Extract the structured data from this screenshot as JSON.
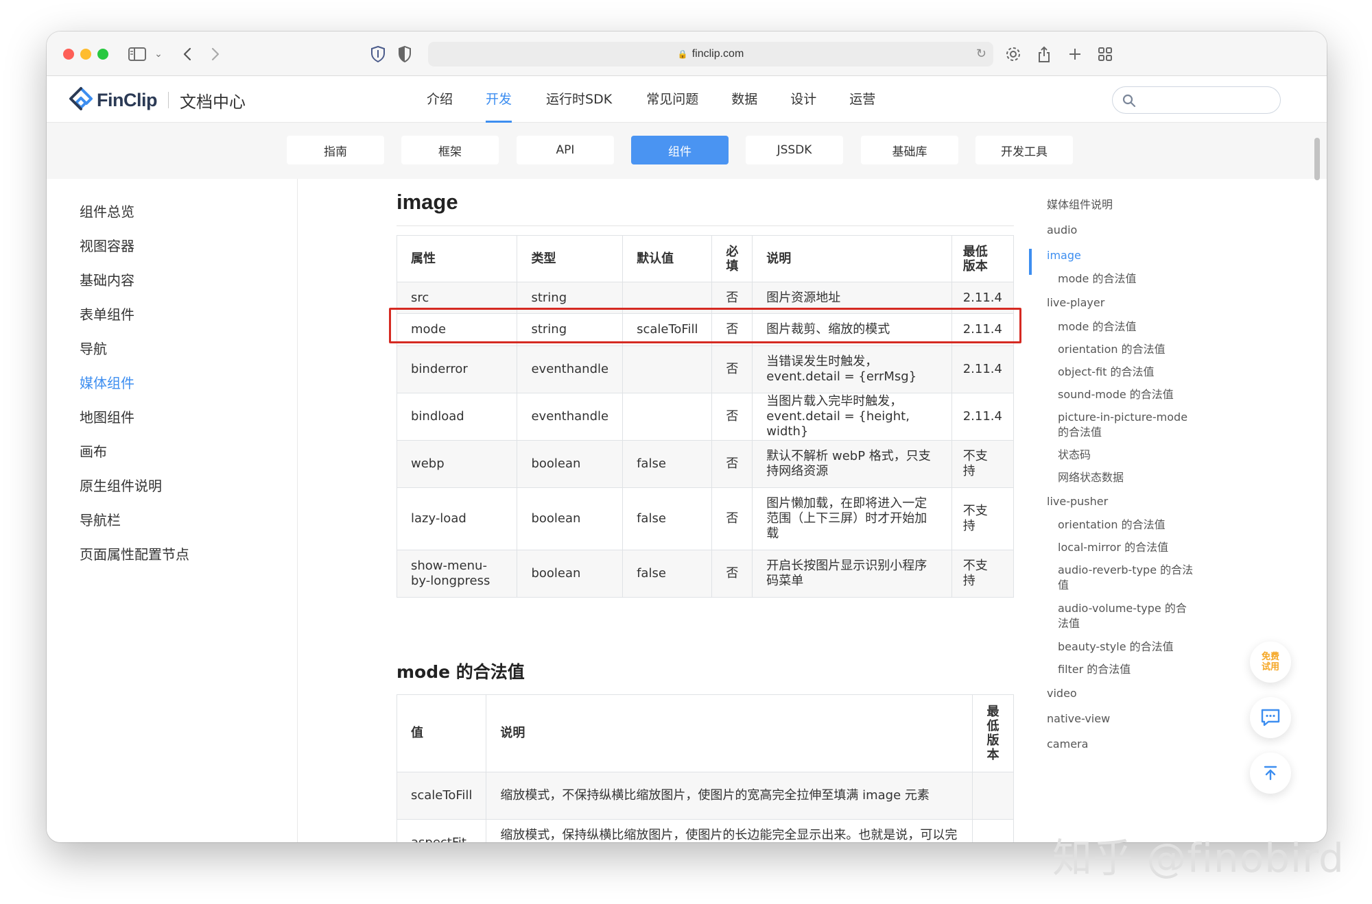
{
  "browser": {
    "url": "finclip.com"
  },
  "site": {
    "logo_text": "FinClip",
    "logo_subtitle": "文档中心",
    "nav": [
      {
        "label": "介绍"
      },
      {
        "label": "开发"
      },
      {
        "label": "运行时SDK"
      },
      {
        "label": "常见问题"
      },
      {
        "label": "数据"
      },
      {
        "label": "设计"
      },
      {
        "label": "运营"
      }
    ],
    "nav_active": "开发",
    "search_placeholder": ""
  },
  "subnav": [
    {
      "label": "指南"
    },
    {
      "label": "框架"
    },
    {
      "label": "API"
    },
    {
      "label": "组件"
    },
    {
      "label": "JSSDK"
    },
    {
      "label": "基础库"
    },
    {
      "label": "开发工具"
    }
  ],
  "subnav_active": "组件",
  "sidebar": [
    {
      "label": "组件总览"
    },
    {
      "label": "视图容器"
    },
    {
      "label": "基础内容"
    },
    {
      "label": "表单组件"
    },
    {
      "label": "导航"
    },
    {
      "label": "媒体组件"
    },
    {
      "label": "地图组件"
    },
    {
      "label": "画布"
    },
    {
      "label": "原生组件说明"
    },
    {
      "label": "导航栏"
    },
    {
      "label": "页面属性配置节点"
    }
  ],
  "sidebar_active": "媒体组件",
  "content": {
    "title": "image",
    "props_table": {
      "headers": [
        "属性",
        "类型",
        "默认值",
        "必填",
        "说明",
        "最低版本"
      ],
      "rows": [
        {
          "attr": "src",
          "type": "string",
          "default": "",
          "required": "否",
          "desc": "图片资源地址",
          "version": "2.11.4"
        },
        {
          "attr": "mode",
          "type": "string",
          "default": "scaleToFill",
          "required": "否",
          "desc": "图片裁剪、缩放的模式",
          "version": "2.11.4"
        },
        {
          "attr": "binderror",
          "type": "eventhandle",
          "default": "",
          "required": "否",
          "desc": "当错误发生时触发，event.detail = {errMsg}",
          "version": "2.11.4"
        },
        {
          "attr": "bindload",
          "type": "eventhandle",
          "default": "",
          "required": "否",
          "desc": "当图片载入完毕时触发，event.detail = {height, width}",
          "version": "2.11.4"
        },
        {
          "attr": "webp",
          "type": "boolean",
          "default": "false",
          "required": "否",
          "desc": "默认不解析 webP 格式，只支持网络资源",
          "version": "不支持"
        },
        {
          "attr": "lazy-load",
          "type": "boolean",
          "default": "false",
          "required": "否",
          "desc": "图片懒加载，在即将进入一定范围（上下三屏）时才开始加载",
          "version": "不支持"
        },
        {
          "attr": "show-menu-by-longpress",
          "type": "boolean",
          "default": "false",
          "required": "否",
          "desc": "开启长按图片显示识别小程序码菜单",
          "version": "不支持"
        }
      ]
    },
    "mode_title": "mode 的合法值",
    "mode_table": {
      "headers": [
        "值",
        "说明",
        "最低版本"
      ],
      "rows": [
        {
          "value": "scaleToFill",
          "desc": "缩放模式，不保持纵横比缩放图片，使图片的宽高完全拉伸至填满 image 元素",
          "version": ""
        },
        {
          "value": "aspectFit",
          "desc": "缩放模式，保持纵横比缩放图片，使图片的长边能完全显示出来。也就是说，可以完整地将图片显示出来。",
          "version": ""
        }
      ]
    }
  },
  "toc": [
    {
      "label": "媒体组件说明",
      "level": 1
    },
    {
      "label": "audio",
      "level": 1
    },
    {
      "label": "image",
      "level": 1
    },
    {
      "label": "mode 的合法值",
      "level": 2
    },
    {
      "label": "live-player",
      "level": 1
    },
    {
      "label": "mode 的合法值",
      "level": 2
    },
    {
      "label": "orientation 的合法值",
      "level": 2
    },
    {
      "label": "object-fit 的合法值",
      "level": 2
    },
    {
      "label": "sound-mode 的合法值",
      "level": 2
    },
    {
      "label": "picture-in-picture-mode 的合法值",
      "level": 2
    },
    {
      "label": "状态码",
      "level": 2
    },
    {
      "label": "网络状态数据",
      "level": 2
    },
    {
      "label": "live-pusher",
      "level": 1
    },
    {
      "label": "orientation 的合法值",
      "level": 2
    },
    {
      "label": "local-mirror 的合法值",
      "level": 2
    },
    {
      "label": "audio-reverb-type 的合法值",
      "level": 2
    },
    {
      "label": "audio-volume-type 的合法值",
      "level": 2
    },
    {
      "label": "beauty-style 的合法值",
      "level": 2
    },
    {
      "label": "filter 的合法值",
      "level": 2
    },
    {
      "label": "video",
      "level": 1
    },
    {
      "label": "native-view",
      "level": 1
    },
    {
      "label": "camera",
      "level": 1
    }
  ],
  "toc_active": "image",
  "floating": {
    "trial_label": "免费试用"
  },
  "watermark": "知乎 @finobird",
  "colors": {
    "accent": "#3d8ef0",
    "highlight_border": "#d52a22"
  }
}
